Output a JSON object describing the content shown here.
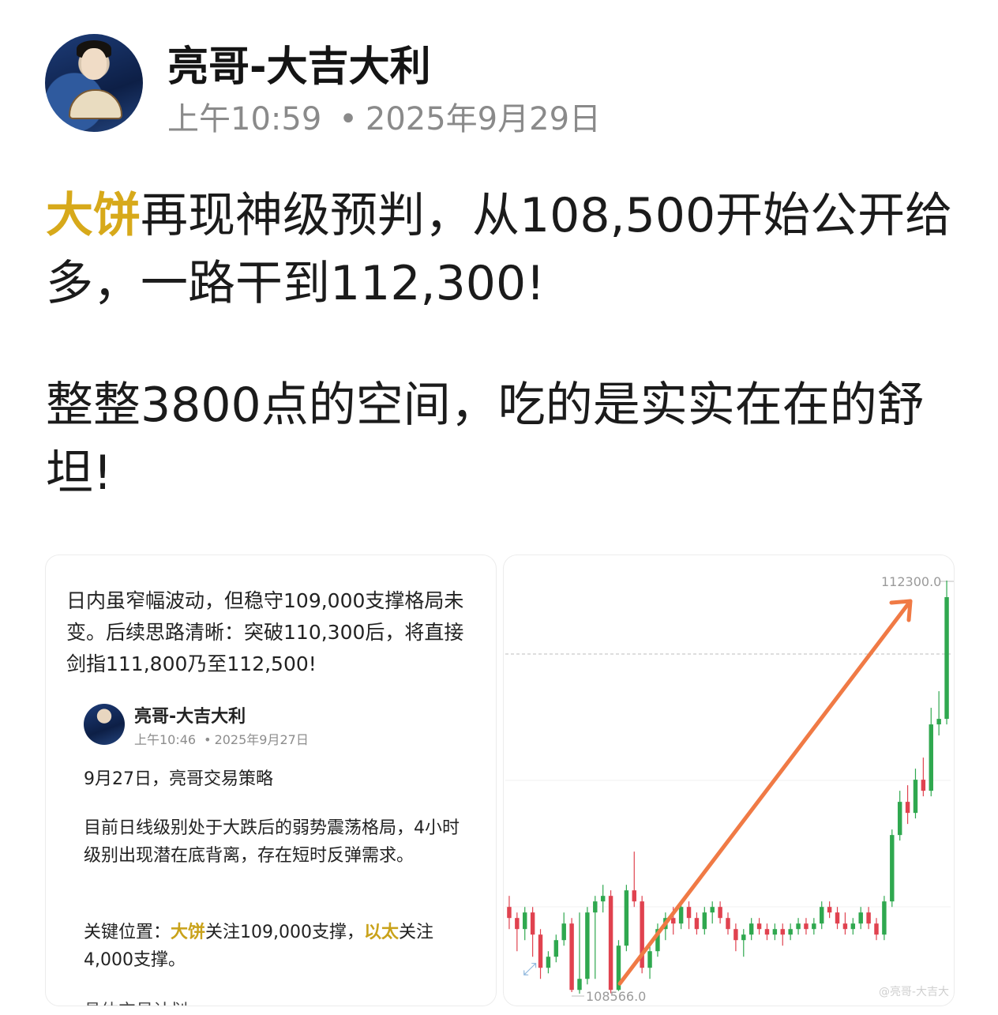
{
  "header": {
    "author_name": "亮哥-大吉大利",
    "time": "上午10:59",
    "date": "2025年9月29日",
    "separator": "•"
  },
  "post": {
    "p1_highlight": "大饼",
    "p1_rest": "再现神级预判，从108,500开始公开给多，一路干到112,300!",
    "p2": "整整3800点的空间，吃的是实实在在的舒坦!"
  },
  "quoted_card": {
    "intro": "日内虽窄幅波动，但稳守109,000支撑格局未变。后续思路清晰：突破110,300后，将直接剑指111,800乃至112,500!",
    "author_name": "亮哥-大吉大利",
    "time": "上午10:46",
    "date": "2025年9月27日",
    "separator": "•",
    "line1": "9月27日，亮哥交易策略",
    "line2": "目前日线级别处于大跌后的弱势震荡格局，4小时级别出现潜在底背离，存在短时反弹需求。",
    "line3_prefix": "关键位置：",
    "line3_hl1": "大饼",
    "line3_mid": "关注109,000支撑，",
    "line3_hl2": "以太",
    "line3_end": "关注4,000支撑。",
    "line4": "具体交易计划"
  },
  "chart_card": {
    "high_label": "112300.0",
    "low_label": "108566.0",
    "watermark": "@亮哥-大吉大",
    "colors": {
      "up": "#2fa84f",
      "down": "#e0424f",
      "arrow": "#f07a45",
      "grid": "#f0f0f0"
    }
  },
  "chart_data": {
    "type": "candlestick",
    "y_range": [
      108566.0,
      112300.0
    ],
    "annotations": [
      "112300.0",
      "108566.0"
    ],
    "trend_arrow": {
      "from": 108600,
      "to": 112300
    },
    "candles": [
      {
        "o": 109350,
        "c": 109250,
        "h": 109450,
        "l": 109150
      },
      {
        "o": 109250,
        "c": 109150,
        "h": 109300,
        "l": 108950
      },
      {
        "o": 109150,
        "c": 109300,
        "h": 109350,
        "l": 109050
      },
      {
        "o": 109300,
        "c": 109100,
        "h": 109350,
        "l": 108900
      },
      {
        "o": 109100,
        "c": 108800,
        "h": 109150,
        "l": 108700
      },
      {
        "o": 108800,
        "c": 108900,
        "h": 108950,
        "l": 108750
      },
      {
        "o": 108900,
        "c": 109050,
        "h": 109100,
        "l": 108850
      },
      {
        "o": 109050,
        "c": 109200,
        "h": 109300,
        "l": 109000
      },
      {
        "o": 109200,
        "c": 108600,
        "h": 109250,
        "l": 108580
      },
      {
        "o": 108600,
        "c": 108700,
        "h": 109300,
        "l": 108566
      },
      {
        "o": 108700,
        "c": 109300,
        "h": 109350,
        "l": 108650
      },
      {
        "o": 109300,
        "c": 109400,
        "h": 109450,
        "l": 108700
      },
      {
        "o": 109400,
        "c": 109450,
        "h": 109550,
        "l": 109300
      },
      {
        "o": 109450,
        "c": 108600,
        "h": 109500,
        "l": 108570
      },
      {
        "o": 108600,
        "c": 109000,
        "h": 109050,
        "l": 108590
      },
      {
        "o": 109000,
        "c": 109500,
        "h": 109550,
        "l": 108950
      },
      {
        "o": 109500,
        "c": 109400,
        "h": 109850,
        "l": 109350
      },
      {
        "o": 109400,
        "c": 108800,
        "h": 109450,
        "l": 108750
      },
      {
        "o": 108800,
        "c": 108950,
        "h": 109000,
        "l": 108700
      },
      {
        "o": 108950,
        "c": 109150,
        "h": 109200,
        "l": 108900
      },
      {
        "o": 109150,
        "c": 109250,
        "h": 109300,
        "l": 109050
      },
      {
        "o": 109250,
        "c": 109200,
        "h": 109350,
        "l": 109100
      },
      {
        "o": 109200,
        "c": 109350,
        "h": 109400,
        "l": 109150
      },
      {
        "o": 109350,
        "c": 109250,
        "h": 109400,
        "l": 109150
      },
      {
        "o": 109250,
        "c": 109150,
        "h": 109300,
        "l": 109100
      },
      {
        "o": 109150,
        "c": 109300,
        "h": 109350,
        "l": 109100
      },
      {
        "o": 109300,
        "c": 109350,
        "h": 109400,
        "l": 109200
      },
      {
        "o": 109350,
        "c": 109250,
        "h": 109400,
        "l": 109200
      },
      {
        "o": 109250,
        "c": 109150,
        "h": 109300,
        "l": 109100
      },
      {
        "o": 109150,
        "c": 109050,
        "h": 109200,
        "l": 108950
      },
      {
        "o": 109050,
        "c": 109100,
        "h": 109150,
        "l": 108900
      },
      {
        "o": 109100,
        "c": 109200,
        "h": 109250,
        "l": 109050
      },
      {
        "o": 109200,
        "c": 109150,
        "h": 109250,
        "l": 109100
      },
      {
        "o": 109150,
        "c": 109100,
        "h": 109200,
        "l": 109050
      },
      {
        "o": 109100,
        "c": 109150,
        "h": 109200,
        "l": 109050
      },
      {
        "o": 109150,
        "c": 109100,
        "h": 109200,
        "l": 109000
      },
      {
        "o": 109100,
        "c": 109150,
        "h": 109200,
        "l": 109050
      },
      {
        "o": 109150,
        "c": 109200,
        "h": 109250,
        "l": 109100
      },
      {
        "o": 109200,
        "c": 109150,
        "h": 109250,
        "l": 109100
      },
      {
        "o": 109150,
        "c": 109200,
        "h": 109250,
        "l": 109100
      },
      {
        "o": 109200,
        "c": 109350,
        "h": 109400,
        "l": 109150
      },
      {
        "o": 109350,
        "c": 109300,
        "h": 109400,
        "l": 109250
      },
      {
        "o": 109300,
        "c": 109200,
        "h": 109350,
        "l": 109150
      },
      {
        "o": 109200,
        "c": 109150,
        "h": 109300,
        "l": 109100
      },
      {
        "o": 109150,
        "c": 109200,
        "h": 109250,
        "l": 109100
      },
      {
        "o": 109200,
        "c": 109300,
        "h": 109350,
        "l": 109150
      },
      {
        "o": 109300,
        "c": 109200,
        "h": 109350,
        "l": 109150
      },
      {
        "o": 109200,
        "c": 109100,
        "h": 109250,
        "l": 109050
      },
      {
        "o": 109100,
        "c": 109400,
        "h": 109450,
        "l": 109050
      },
      {
        "o": 109400,
        "c": 110000,
        "h": 110050,
        "l": 109350
      },
      {
        "o": 110000,
        "c": 110300,
        "h": 110400,
        "l": 109950
      },
      {
        "o": 110300,
        "c": 110200,
        "h": 110450,
        "l": 110100
      },
      {
        "o": 110200,
        "c": 110500,
        "h": 110600,
        "l": 110150
      },
      {
        "o": 110500,
        "c": 110400,
        "h": 110700,
        "l": 110350
      },
      {
        "o": 110400,
        "c": 111000,
        "h": 111150,
        "l": 110350
      },
      {
        "o": 111000,
        "c": 111050,
        "h": 111300,
        "l": 110900
      },
      {
        "o": 111050,
        "c": 112150,
        "h": 112300,
        "l": 111000
      }
    ]
  }
}
